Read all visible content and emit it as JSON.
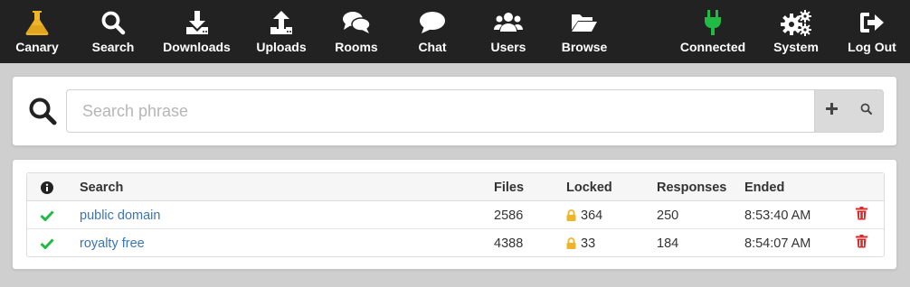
{
  "nav": {
    "items": [
      {
        "key": "canary",
        "label": "Canary",
        "icon": "flask-icon"
      },
      {
        "key": "search",
        "label": "Search",
        "icon": "search-icon"
      },
      {
        "key": "downloads",
        "label": "Downloads",
        "icon": "download-icon"
      },
      {
        "key": "uploads",
        "label": "Uploads",
        "icon": "upload-icon"
      },
      {
        "key": "rooms",
        "label": "Rooms",
        "icon": "comments-icon"
      },
      {
        "key": "chat",
        "label": "Chat",
        "icon": "comment-icon"
      },
      {
        "key": "users",
        "label": "Users",
        "icon": "users-icon"
      },
      {
        "key": "browse",
        "label": "Browse",
        "icon": "folder-open-icon"
      },
      {
        "key": "connected",
        "label": "Connected",
        "icon": "plug-icon"
      },
      {
        "key": "system",
        "label": "System",
        "icon": "cogs-icon"
      },
      {
        "key": "logout",
        "label": "Log Out",
        "icon": "sign-out-icon"
      }
    ]
  },
  "colors": {
    "navbar_bg": "#222222",
    "canary_accent": "#f0b429",
    "connected_accent": "#21ba45",
    "link": "#3a75b5",
    "delete": "#db2828",
    "success": "#21ba45",
    "lock": "#f0b429"
  },
  "search": {
    "placeholder": "Search phrase",
    "value": "",
    "add_icon": "plus-icon",
    "submit_icon": "search-icon"
  },
  "results": {
    "columns": {
      "status": "info-circle-icon",
      "search": "Search",
      "files": "Files",
      "locked": "Locked",
      "responses": "Responses",
      "ended": "Ended"
    },
    "rows": [
      {
        "status": "check-icon",
        "search": "public domain",
        "files": "2586",
        "locked": "364",
        "responses": "250",
        "ended": "8:53:40 AM"
      },
      {
        "status": "check-icon",
        "search": "royalty free",
        "files": "4388",
        "locked": "33",
        "responses": "184",
        "ended": "8:54:07 AM"
      }
    ]
  }
}
